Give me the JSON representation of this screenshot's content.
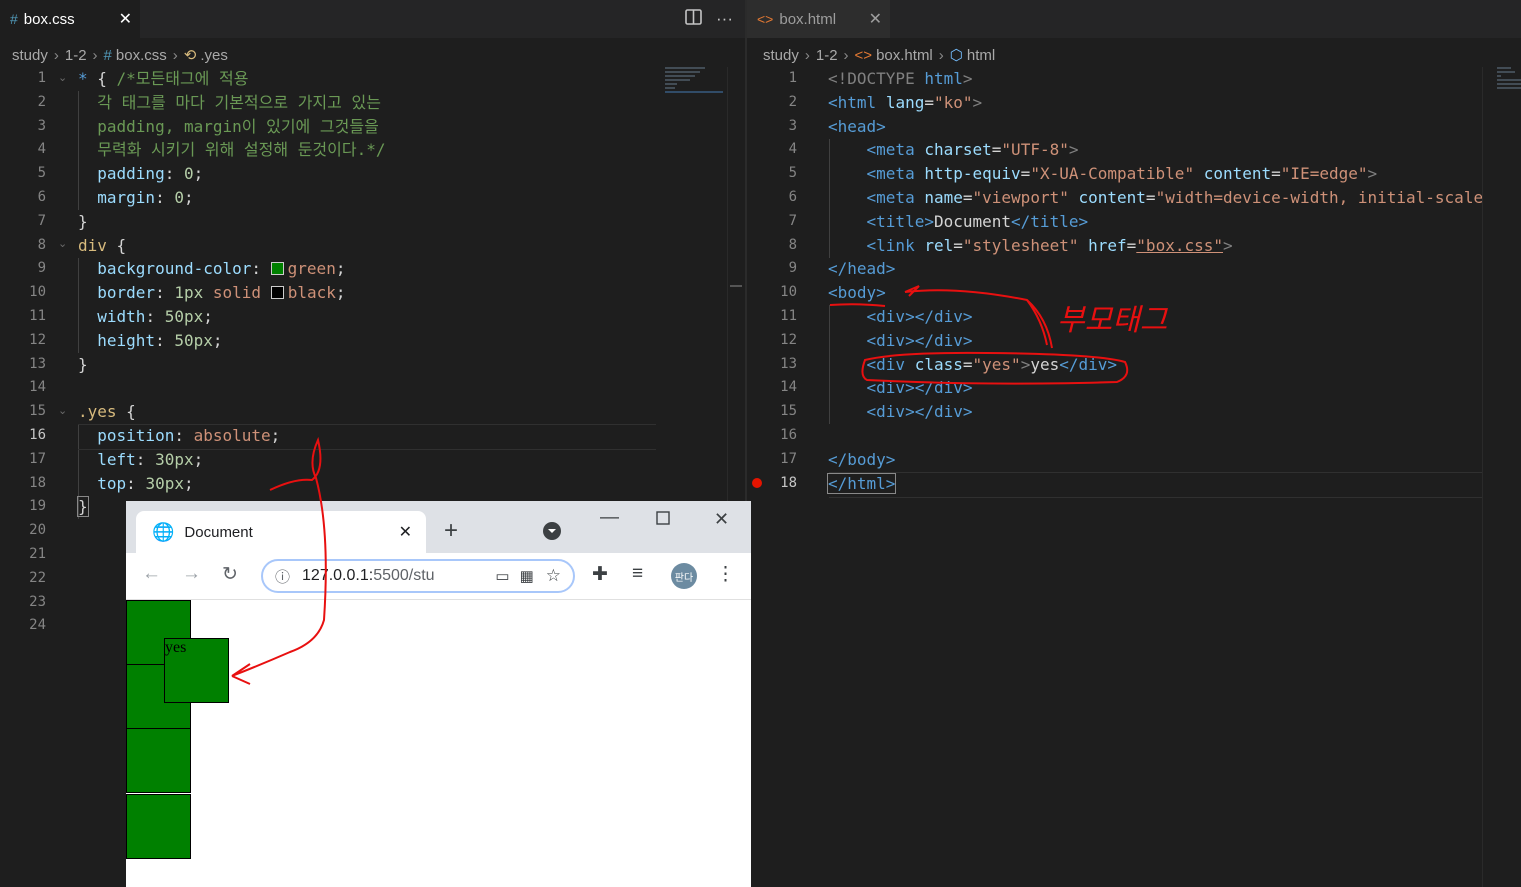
{
  "left_editor": {
    "tab": {
      "icon": "#",
      "label": "box.css"
    },
    "breadcrumb": [
      "study",
      "1-2",
      "box.css",
      ".yes"
    ],
    "line_numbers": [
      "1",
      "2",
      "3",
      "4",
      "5",
      "6",
      "7",
      "8",
      "9",
      "10",
      "11",
      "12",
      "13",
      "14",
      "15",
      "16",
      "17",
      "18",
      "19",
      "20",
      "21",
      "22",
      "23",
      "24"
    ],
    "active_line": "16",
    "code": {
      "l1_sel": "* ",
      "l1_brace": "{ ",
      "l1_comment": "/*모든태그에 적용",
      "l2_comment": "각 태그를 마다 기본적으로 가지고 있는",
      "l3_comment": "padding, margin이 있기에 그것들을",
      "l4_comment": "무력화 시키기 위해 설정해 둔것이다.*/",
      "l5_prop": "padding",
      "l5_val": "0",
      "l6_prop": "margin",
      "l6_val": "0",
      "l7_brace": "}",
      "l8_sel": "div",
      "l8_brace": " {",
      "l9_prop": "background-color",
      "l9_val": "green",
      "l10_prop": "border",
      "l10_num": "1px",
      "l10_kw": "solid",
      "l10_val": "black",
      "l11_prop": "width",
      "l11_val": "50px",
      "l12_prop": "height",
      "l12_val": "50px",
      "l13_brace": "}",
      "l15_sel": ".yes",
      "l15_brace": " {",
      "l16_prop": "position",
      "l16_val": "absolute",
      "l17_prop": "left",
      "l17_val": "30px",
      "l18_prop": "top",
      "l18_val": "30px",
      "l19_brace": "}"
    },
    "swatch_colors": {
      "green": "#008000",
      "black": "#000000"
    }
  },
  "right_editor": {
    "tab": {
      "label": "box.html"
    },
    "breadcrumb": [
      "study",
      "1-2",
      "box.html",
      "html"
    ],
    "line_numbers": [
      "1",
      "2",
      "3",
      "4",
      "5",
      "6",
      "7",
      "8",
      "9",
      "10",
      "11",
      "12",
      "13",
      "14",
      "15",
      "16",
      "17",
      "18"
    ],
    "active_line": "18",
    "code": {
      "doctype": "<!DOCTYPE",
      "doctype_html": "html",
      "html_tag": "<html",
      "lang_attr": "lang",
      "lang_val": "\"ko\"",
      "head_open": "<head>",
      "meta": "<meta",
      "charset_attr": "charset",
      "charset_val": "\"UTF-8\"",
      "httpequiv_attr": "http-equiv",
      "httpequiv_val": "\"X-UA-Compatible\"",
      "content_attr": "content",
      "content_val": "\"IE=edge\"",
      "name_attr": "name",
      "name_val": "\"viewport\"",
      "viewport_val": "\"width=device-width, initial-scale",
      "title_open": "<title>",
      "title_text": "Document",
      "title_close": "</title>",
      "link": "<link",
      "rel_attr": "rel",
      "rel_val": "\"stylesheet\"",
      "href_attr": "href",
      "href_val": "\"box.css\"",
      "head_close": "</head>",
      "body_open": "<body>",
      "div_open": "<div>",
      "div_close": "</div>",
      "div_yes_open": "<div",
      "class_attr": "class",
      "class_val": "\"yes\"",
      "yes_text": "yes",
      "body_close": "</body>",
      "html_close": "</html>"
    }
  },
  "annotation": {
    "handwritten_label": "부모태그",
    "ink_color": "#e81010"
  },
  "browser": {
    "tab_title": "Document",
    "url_host": "127.0.0.1:",
    "url_port": "5500",
    "url_path": "/stu",
    "profile_label": "판다",
    "yes_box_text": "yes"
  }
}
